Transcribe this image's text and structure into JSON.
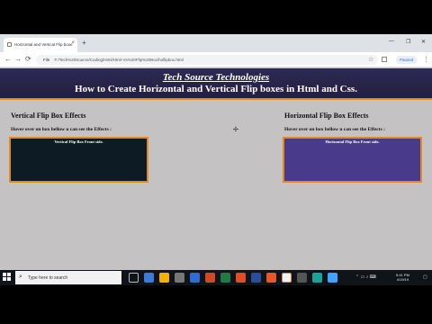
{
  "browser": {
    "tab_title": "Horizontal and Vertical Flip boxe",
    "tab_close": "×",
    "new_tab": "+",
    "win_min": "—",
    "win_max": "❐",
    "win_close": "✕",
    "back": "←",
    "forward": "→",
    "reload": "⟳",
    "url_scheme": "File",
    "url": "F:/Tech%20Source/Coding/Html/Html-Vs%20Flip%20Box/hoflipbox.html",
    "star": "☆",
    "paused": "Paused",
    "menu": "⋮"
  },
  "page": {
    "brand": "Tech Source Technologies",
    "title": "How to Create Horizontal and Vertical Flip boxes in Html and Css.",
    "vertical": {
      "heading": "Vertical Flip Box Effects",
      "hint": "Hover over on box bellow u can see the Effects :",
      "front_text": "Vertical Flip Box Front side."
    },
    "horizontal": {
      "heading": "Horizontal Flip Box Effects",
      "hint": "Hover over on box bellow u can see the Effects :",
      "front_text": "Horizontal Flip Box Front side."
    }
  },
  "taskbar": {
    "search_placeholder": "Type here to search",
    "time": "5:41 PM",
    "date": "4/19/19"
  },
  "colors": {
    "header_bg": "#2c2a55",
    "accent_border": "#e08a20",
    "vertical_box": "#0d1b24",
    "horizontal_box": "#4a3a8c",
    "page_bg": "#c4c2c2"
  }
}
